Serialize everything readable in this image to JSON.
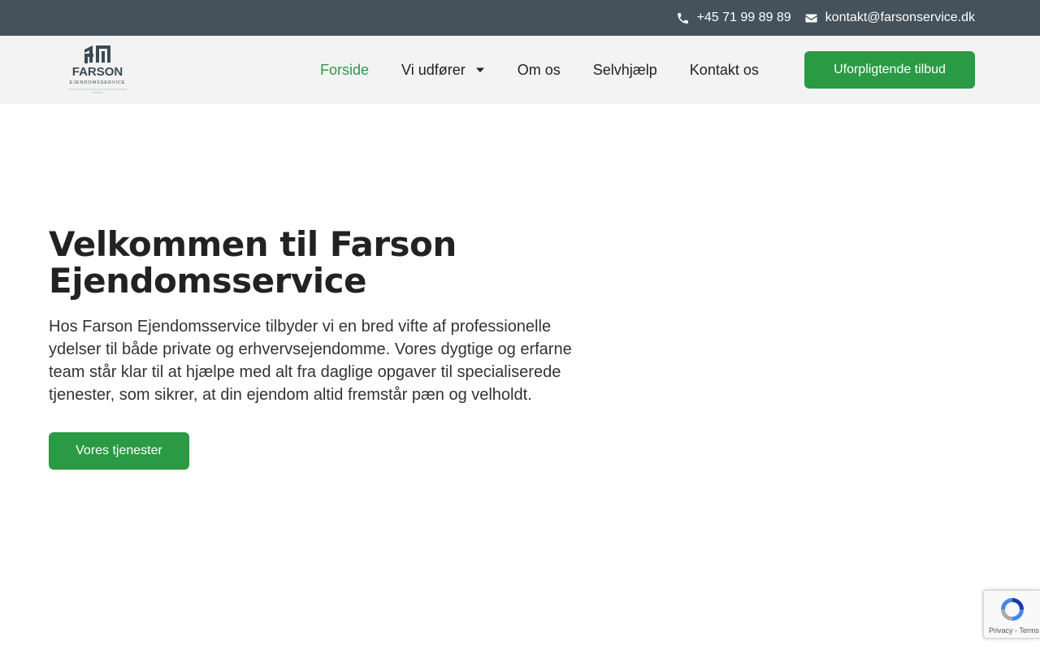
{
  "topbar": {
    "phone": "+45 71 99 89 89",
    "phone_icon": "phone-icon",
    "email": "kontakt@farsonservice.dk",
    "email_icon": "envelope-icon"
  },
  "logo": {
    "name": "FARSON",
    "subtitle": "EJENDOMSSERVICE"
  },
  "nav": {
    "items": [
      {
        "label": "Forside",
        "active": true
      },
      {
        "label": "Vi udfører",
        "has_dropdown": true
      },
      {
        "label": "Om os"
      },
      {
        "label": "Selvhjælp"
      },
      {
        "label": "Kontakt os"
      }
    ],
    "cta_label": "Uforpligtende tilbud"
  },
  "hero": {
    "title": "Velkommen til Farson Ejendomsservice",
    "body": "Hos Farson Ejendomsservice tilbyder vi en bred vifte af professionelle ydelser til både private og erhvervsejendomme. Vores dygtige og erfarne team står klar til at hjælpe med alt fra daglige opgaver til specialiserede tjenester, som sikrer, at din ejendom altid fremstår pæn og velholdt.",
    "button_label": "Vores tjenester"
  },
  "recaptcha": {
    "terms": "Privacy - Terms"
  },
  "colors": {
    "topbar": "#45525c",
    "header": "#f3f3f3",
    "accent_green": "#2a9a44",
    "text": "#222222"
  }
}
